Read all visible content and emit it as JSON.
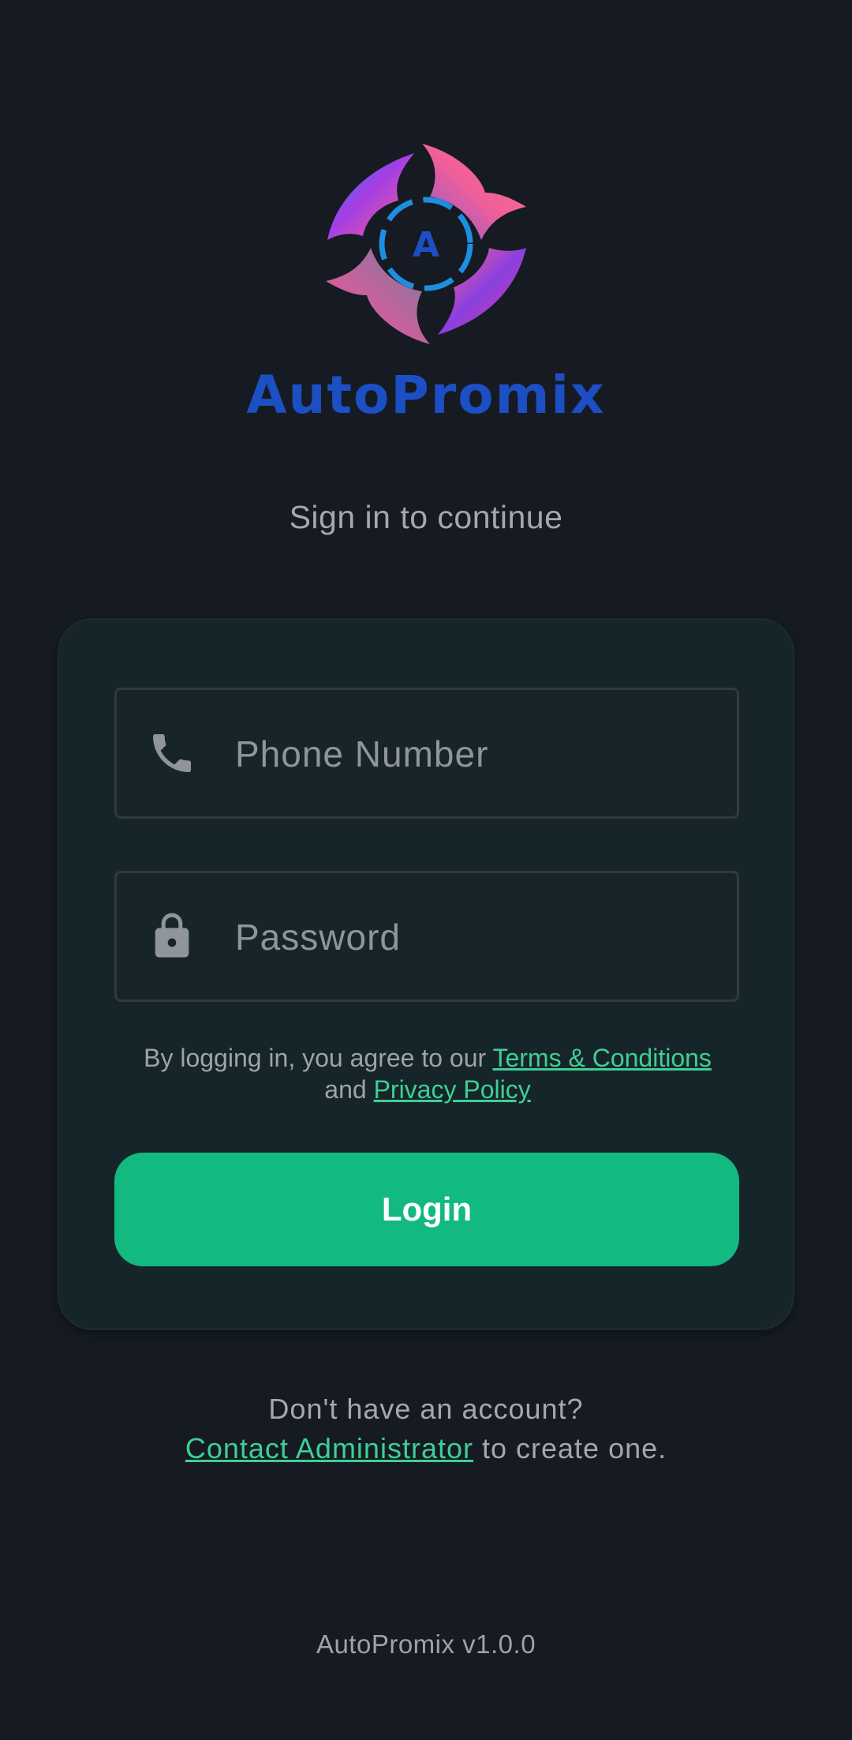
{
  "brand": {
    "name": "AutoPromix",
    "logo_letter": "A",
    "logo_icon": "flame-swirl-logo",
    "brand_color": "#1c4fc4"
  },
  "subtitle": "Sign in to continue",
  "form": {
    "phone": {
      "placeholder": "Phone Number",
      "value": "",
      "icon": "phone-icon"
    },
    "password": {
      "placeholder": "Password",
      "value": "",
      "icon": "lock-icon"
    },
    "terms": {
      "prefix": "By logging in, you agree to our",
      "terms_link": "Terms & Conditions",
      "and": "and",
      "privacy_link": "Privacy Policy"
    },
    "login_label": "Login"
  },
  "account": {
    "question": "Don't have an account?",
    "contact_link": "Contact Administrator",
    "suffix": "to create one."
  },
  "version": "AutoPromix v1.0.0",
  "colors": {
    "background": "#161a22",
    "card": "#16252a",
    "accent": "#12b981",
    "link": "#3ecf94"
  }
}
